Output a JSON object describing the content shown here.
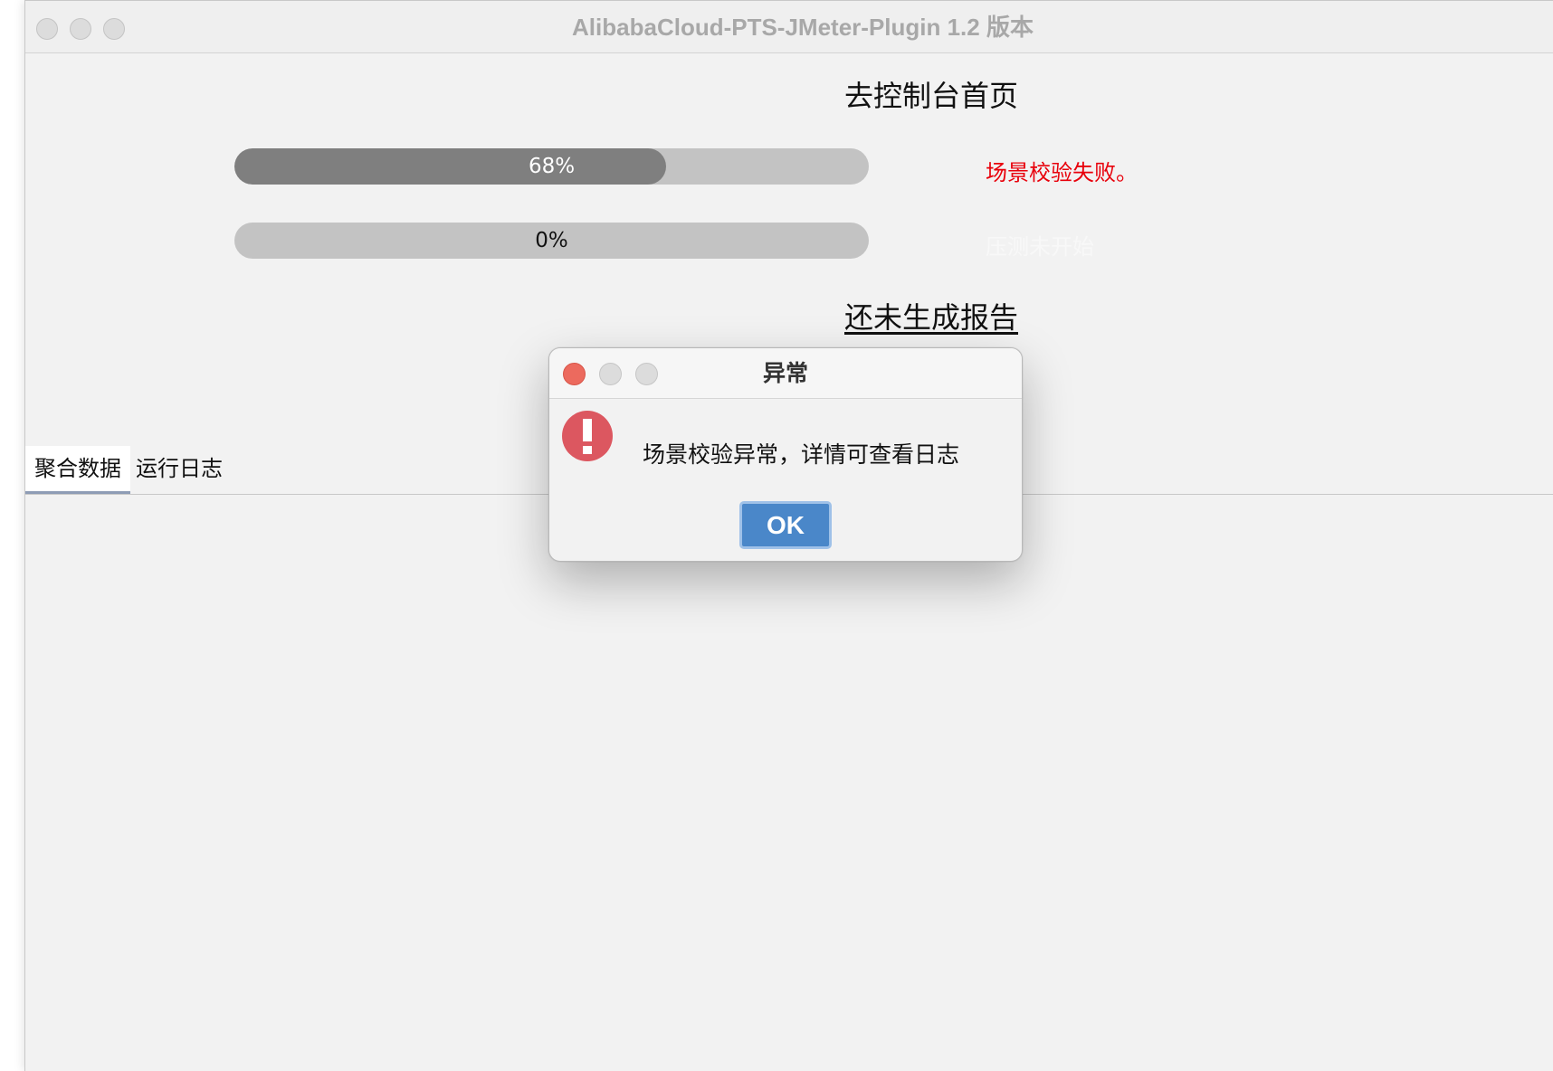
{
  "window": {
    "title": "AlibabaCloud-PTS-JMeter-Plugin 1.2 版本"
  },
  "main": {
    "console_link": "去控制台首页",
    "scene_check": {
      "progress_percent": 68,
      "progress_label": "68%",
      "status_text": "场景校验失败。",
      "status_color": "#e8000b"
    },
    "pressure_test": {
      "progress_percent": 0,
      "progress_label": "0%",
      "status_text": "压测未开始",
      "status_color": "#f8f8f8"
    },
    "report_link": "还未生成报告",
    "tabs": [
      {
        "label": "聚合数据",
        "active": true
      },
      {
        "label": "运行日志",
        "active": false
      }
    ]
  },
  "dialog": {
    "title": "异常",
    "icon": "error-icon",
    "message": "场景校验异常，详情可查看日志",
    "ok_label": "OK"
  },
  "colors": {
    "progress_track": "#c3c3c3",
    "progress_fill": "#7f7f7f",
    "ok_button": "#4a87c9",
    "error_icon": "#dc5760"
  }
}
